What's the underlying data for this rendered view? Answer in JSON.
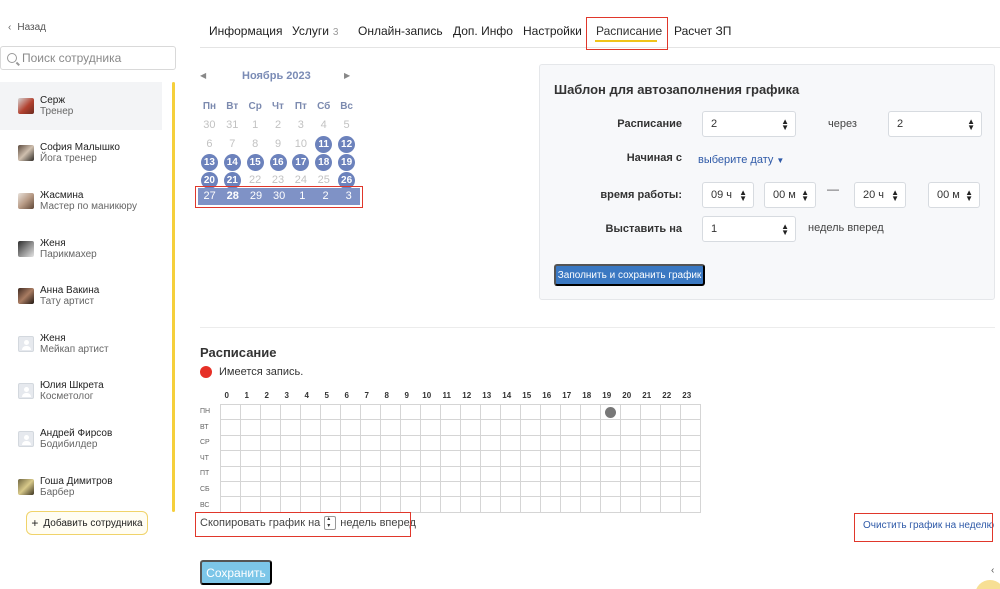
{
  "sidebar": {
    "back_label": "Назад",
    "search_placeholder": "Поиск сотрудника",
    "employees": [
      {
        "name": "Серж",
        "role": "Тренер"
      },
      {
        "name": "София Малышко",
        "role": "Йога тренер"
      },
      {
        "name": "Жасмина",
        "role": "Мастер по маникюру"
      },
      {
        "name": "Женя",
        "role": "Парикмахер"
      },
      {
        "name": "Анна Вакина",
        "role": "Тату артист"
      },
      {
        "name": "Женя",
        "role": "Мейкап артист"
      },
      {
        "name": "Юлия Шкрета",
        "role": "Косметолог"
      },
      {
        "name": "Андрей Фирсов",
        "role": "Бодибилдер"
      },
      {
        "name": "Гоша Димитров",
        "role": "Барбер"
      }
    ],
    "add_label": "Добавить сотрудника"
  },
  "tabs": [
    {
      "label": "Информация"
    },
    {
      "label": "Услуги",
      "count": "3"
    },
    {
      "label": "Онлайн-запись"
    },
    {
      "label": "Доп. Инфо"
    },
    {
      "label": "Настройки"
    },
    {
      "label": "Расписание",
      "active": true
    },
    {
      "label": "Расчет ЗП"
    }
  ],
  "calendar": {
    "month_title": "Ноябрь 2023",
    "weekdays": [
      "Пн",
      "Вт",
      "Ср",
      "Чт",
      "Пт",
      "Сб",
      "Вс"
    ],
    "weeks": [
      [
        "30",
        "31",
        "1",
        "2",
        "3",
        "4",
        "5"
      ],
      [
        "6",
        "7",
        "8",
        "9",
        "10",
        "11",
        "12"
      ],
      [
        "13",
        "14",
        "15",
        "16",
        "17",
        "18",
        "19"
      ],
      [
        "20",
        "21",
        "22",
        "23",
        "24",
        "25",
        "26"
      ]
    ],
    "selected_week": [
      "27",
      "28",
      "29",
      "30",
      "1",
      "2",
      "3"
    ]
  },
  "template": {
    "title": "Шаблон для автозаполнения графика",
    "schedule_label": "Расписание",
    "schedule_value": "2",
    "through_label": "через",
    "through_value": "2",
    "start_label": "Начиная с",
    "start_value": "выберите дату",
    "work_time_label": "время работы:",
    "start_hour": "09 ч",
    "start_min": "00 м",
    "dash": "—",
    "end_hour": "20 ч",
    "end_min": "00 м",
    "set_for_label": "Выставить на",
    "set_for_value": "1",
    "weeks_ahead_label": "недель вперед",
    "fill_button": "Заполнить и сохранить график"
  },
  "schedule": {
    "title": "Расписание",
    "legend_text": "Имеется запись.",
    "hours": [
      "0",
      "1",
      "2",
      "3",
      "4",
      "5",
      "6",
      "7",
      "8",
      "9",
      "10",
      "11",
      "12",
      "13",
      "14",
      "15",
      "16",
      "17",
      "18",
      "19",
      "20",
      "21",
      "22",
      "23"
    ],
    "days": [
      "ПН",
      "ВТ",
      "СР",
      "ЧТ",
      "ПТ",
      "СБ",
      "ВС"
    ],
    "copy_prefix": "Скопировать график на",
    "copy_suffix": "недель вперед",
    "clear_link": "Очистить график на неделю",
    "save_button": "Сохранить"
  },
  "colors": {
    "accent": "#f0c419",
    "annotation": "#e0372b",
    "calendar_selected": "#6c82bc",
    "primary_button": "#3a78c2",
    "save_button": "#7cc6e8",
    "booking_dot": "#e63027"
  }
}
